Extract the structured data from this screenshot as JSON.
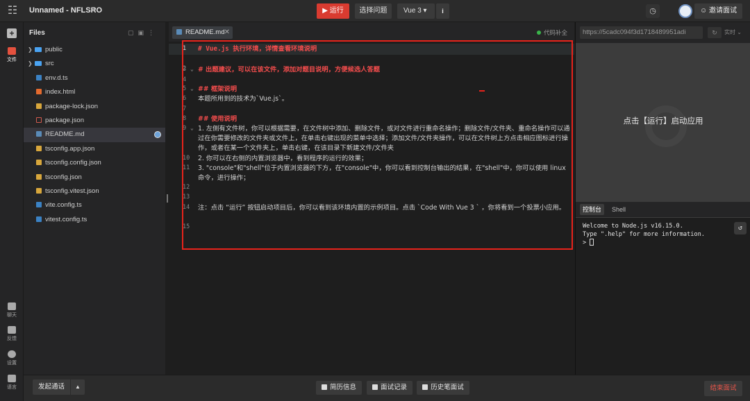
{
  "app": {
    "title": "Unnamed - NFLSRO",
    "run_label": "运行",
    "select_label": "选择问题",
    "framework": "Vue 3",
    "invite_label": "邀请面试"
  },
  "rail": {
    "files_label": "文件",
    "chat_label": "聊天",
    "feedback_label": "反馈",
    "settings_label": "设置",
    "language_label": "语言"
  },
  "files": {
    "header": "Files",
    "items": [
      {
        "name": "public",
        "kind": "folder"
      },
      {
        "name": "src",
        "kind": "folder"
      },
      {
        "name": "env.d.ts",
        "kind": "ts"
      },
      {
        "name": "index.html",
        "kind": "html"
      },
      {
        "name": "package-lock.json",
        "kind": "json"
      },
      {
        "name": "package.json",
        "kind": "pkg"
      },
      {
        "name": "README.md",
        "kind": "md"
      },
      {
        "name": "tsconfig.app.json",
        "kind": "json"
      },
      {
        "name": "tsconfig.config.json",
        "kind": "json"
      },
      {
        "name": "tsconfig.json",
        "kind": "json"
      },
      {
        "name": "tsconfig.vitest.json",
        "kind": "json"
      },
      {
        "name": "vite.config.ts",
        "kind": "ts"
      },
      {
        "name": "vitest.config.ts",
        "kind": "ts"
      }
    ]
  },
  "editor": {
    "tab_label": "README.md",
    "completion_label": "代码补全",
    "lines": [
      {
        "n": "1",
        "text": "# Vue.js 执行环境，详情查看环境说明"
      },
      {
        "n": "2",
        "text": ""
      },
      {
        "n": "3",
        "text": "# 出题建议，可以在该文件，添加对题目说明，方便候选人答题"
      },
      {
        "n": "4",
        "text": ""
      },
      {
        "n": "5",
        "text": "## 框架说明"
      },
      {
        "n": "6",
        "text": "本题所用到的技术为`Vue.js`。"
      },
      {
        "n": "7",
        "text": ""
      },
      {
        "n": "8",
        "text": "## 使用说明"
      },
      {
        "n": "9",
        "text": "1. 左侧有文件树，你可以根据需要，在文件树中添加、删除文件，或对文件进行重命名操作；删除文件/文件夹、重命名操作可以通过在你需要修改的文件夹或文件上，在单击右键出现的菜单中选择；添加文件/文件夹操作，可以在文件树上方点击相应图标进行操作，或者在某一个文件夹上，单击右键，在该目录下新建文件/文件夹"
      },
      {
        "n": "10",
        "text": "2. 你可以在右侧的内置浏览器中，看到程序的运行的效果；"
      },
      {
        "n": "11",
        "text": "3. \"console\"和\"shell\"位于内置浏览器的下方，在\"console\"中，你可以看到控制台输出的结果，在\"shell\"中，你可以使用 linux 命令，进行操作；"
      },
      {
        "n": "12",
        "text": ""
      },
      {
        "n": "13",
        "text": ""
      },
      {
        "n": "14",
        "text": "注：点击 “运行” 按钮启动项目后，你可以看到该环境内置的示例项目。点击 `Code With Vue 3 ` ，你将看到一个投票小应用。"
      },
      {
        "n": "15",
        "text": ""
      }
    ]
  },
  "preview": {
    "url": "https://5cadc094f3d1718489951adi",
    "mode": "实时",
    "message": "点击【运行】启动应用",
    "console_tab": "控制台",
    "shell_tab": "Shell",
    "console_lines": [
      "Welcome to Node.js v16.15.0.",
      "Type \".help\" for more information.",
      "> "
    ]
  },
  "bottom": {
    "call_label": "发起通话",
    "resume_label": "简历信息",
    "record_label": "面试记录",
    "history_label": "历史笔面试",
    "end_label": "结束面试"
  }
}
